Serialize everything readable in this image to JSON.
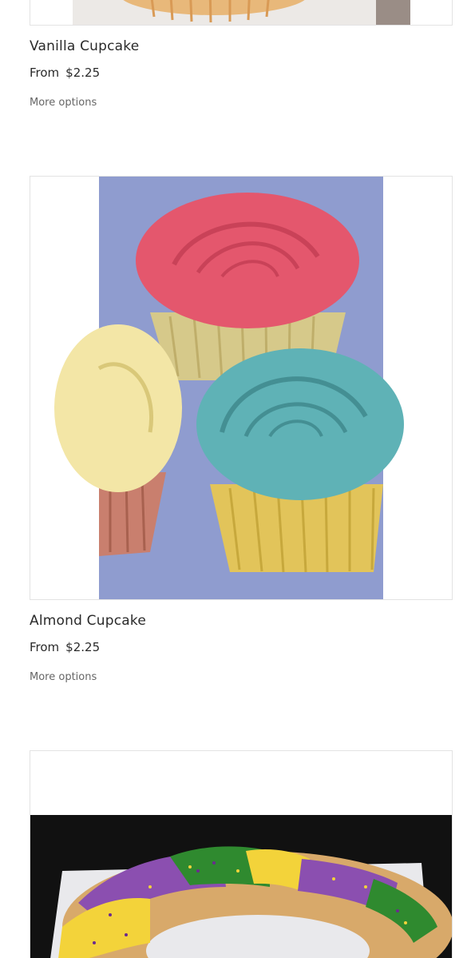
{
  "products": [
    {
      "name": "Vanilla Cupcake",
      "price_prefix": "From",
      "price": "$2.25",
      "more_label": "More options",
      "image_icon": "cupcake-image"
    },
    {
      "name": "Almond Cupcake",
      "price_prefix": "From",
      "price": "$2.25",
      "more_label": "More options",
      "image_icon": "cupcakes-image"
    },
    {
      "name": "",
      "image_icon": "king-cake-image"
    }
  ]
}
